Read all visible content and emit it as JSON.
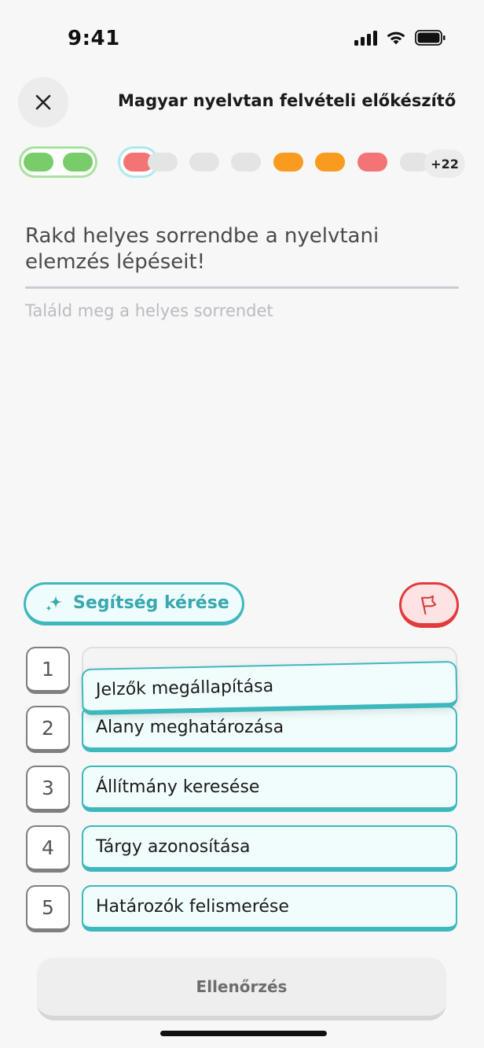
{
  "status": {
    "time": "9:41"
  },
  "header": {
    "title": "Magyar nyelvtan felvételi előkészítő"
  },
  "progress": {
    "segments": [
      "correct",
      "correct",
      "current-wrong",
      "pending",
      "pending",
      "pending",
      "partial",
      "partial",
      "wrong",
      "pending"
    ],
    "more_label": "+22",
    "colors": {
      "correct": "#78cd6a",
      "wrong": "#f27474",
      "partial": "#f89b1f",
      "pending": "#e3e4e4"
    }
  },
  "question": {
    "prompt": "Rakd helyes sorrendbe a nyelvtani elemzés lépéseit!",
    "hint": "Találd meg a helyes sorrendet"
  },
  "help": {
    "label": "Segítség kérése"
  },
  "order": {
    "numbers": [
      "1",
      "2",
      "3",
      "4",
      "5"
    ],
    "items": [
      "Jelzők megállapítása",
      "Alany meghatározása",
      "Állítmány keresése",
      "Tárgy azonosítása",
      "Határozók felismerése"
    ]
  },
  "footer": {
    "check_label": "Ellenőrzés"
  },
  "accent": "#3eb8bd"
}
